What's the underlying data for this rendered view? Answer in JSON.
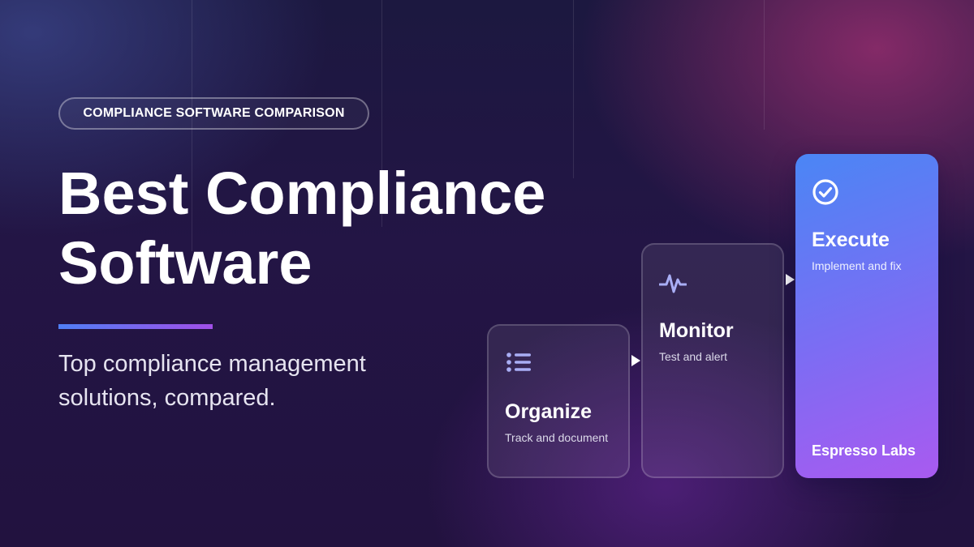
{
  "badge": "COMPLIANCE SOFTWARE COMPARISON",
  "title_line1": "Best Compliance",
  "title_line2": "Software",
  "subtitle_line1": "Top compliance management",
  "subtitle_line2": "solutions, compared.",
  "steps": [
    {
      "title": "Organize",
      "desc": "Track and document",
      "icon": "list-icon"
    },
    {
      "title": "Monitor",
      "desc": "Test and alert",
      "icon": "pulse-icon"
    },
    {
      "title": "Execute",
      "desc": "Implement and fix",
      "icon": "check-circle-icon"
    }
  ],
  "brand": "Espresso Labs",
  "colors": {
    "accent_blue": "#4f7ff5",
    "accent_purple": "#a14fe8",
    "icon_lavender": "#a9aef5"
  }
}
